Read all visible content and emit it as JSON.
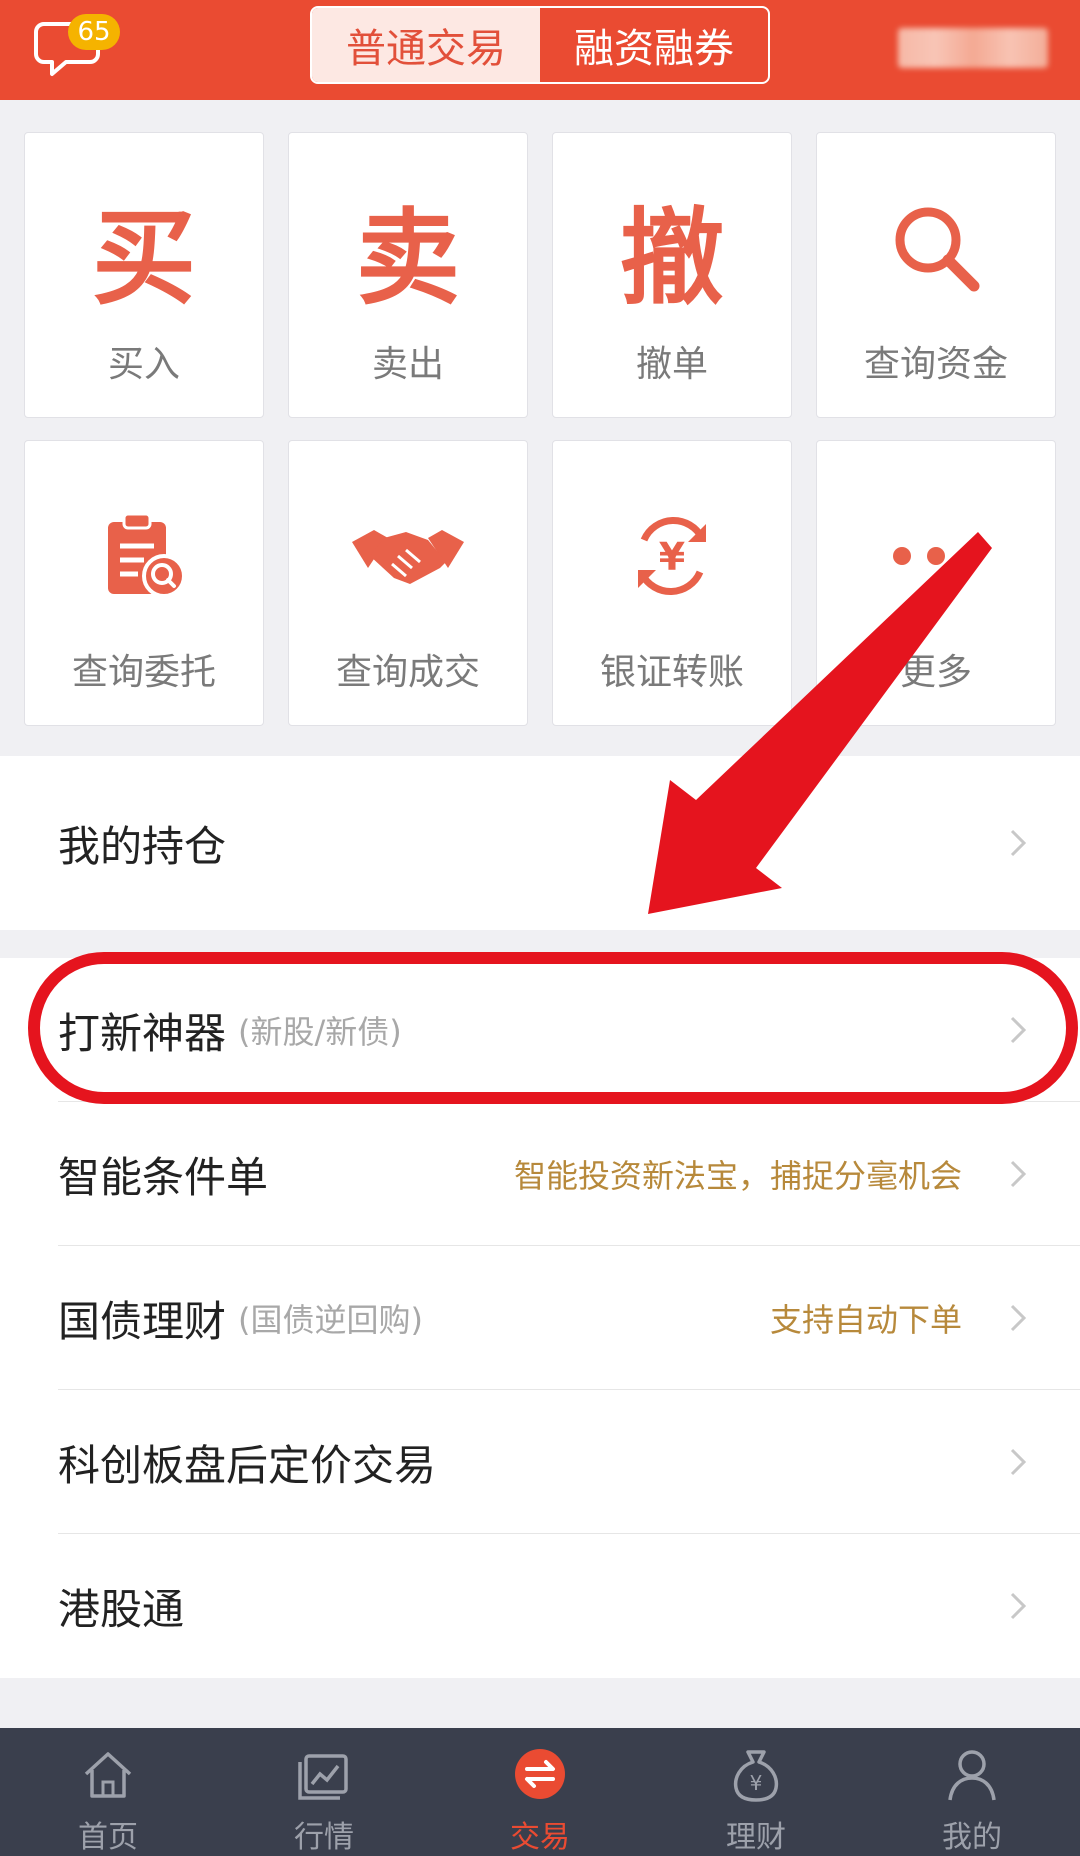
{
  "header": {
    "message_badge": "65",
    "tabs": [
      {
        "label": "普通交易",
        "active": true
      },
      {
        "label": "融资融券",
        "active": false
      }
    ]
  },
  "grid": [
    {
      "glyph": "买",
      "label": "买入",
      "icon": "buy-glyph-icon"
    },
    {
      "glyph": "卖",
      "label": "卖出",
      "icon": "sell-glyph-icon"
    },
    {
      "glyph": "撤",
      "label": "撤单",
      "icon": "cancel-glyph-icon"
    },
    {
      "glyph": "",
      "label": "查询资金",
      "icon": "search-icon"
    },
    {
      "glyph": "",
      "label": "查询委托",
      "icon": "clipboard-search-icon"
    },
    {
      "glyph": "",
      "label": "查询成交",
      "icon": "handshake-icon"
    },
    {
      "glyph": "",
      "label": "银证转账",
      "icon": "yen-exchange-icon"
    },
    {
      "glyph": "",
      "label": "更多",
      "icon": "more-dots-icon"
    }
  ],
  "list": {
    "holdings": {
      "title": "我的持仓"
    },
    "ipo": {
      "title": "打新神器",
      "sub": "(新股/新债)"
    },
    "smart_order": {
      "title": "智能条件单",
      "note": "智能投资新法宝，捕捉分毫机会"
    },
    "treasury": {
      "title": "国债理财",
      "sub": "(国债逆回购)",
      "note": "支持自动下单"
    },
    "star_market": {
      "title": "科创板盘后定价交易"
    },
    "hk_connect": {
      "title": "港股通"
    }
  },
  "bottom_nav": [
    {
      "label": "首页",
      "icon": "home-icon",
      "active": false
    },
    {
      "label": "行情",
      "icon": "chart-icon",
      "active": false
    },
    {
      "label": "交易",
      "icon": "exchange-icon",
      "active": true
    },
    {
      "label": "理财",
      "icon": "money-bag-icon",
      "active": false
    },
    {
      "label": "我的",
      "icon": "user-icon",
      "active": false
    }
  ],
  "colors": {
    "brand_red": "#ea4b32",
    "icon_red": "#e8614a",
    "note_gold": "#b7893b",
    "nav_bg": "#3a3f4d",
    "annotation_red": "#e5141e"
  }
}
